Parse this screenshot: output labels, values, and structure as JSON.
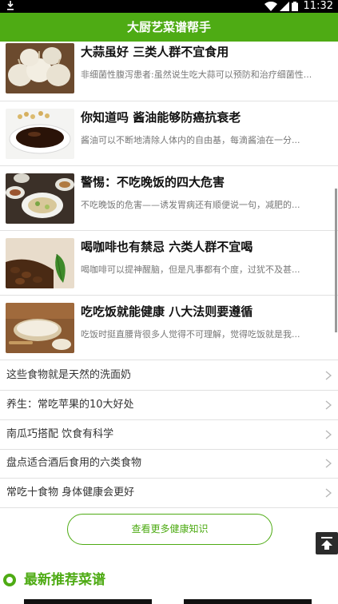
{
  "status_bar": {
    "download_icon": "download-icon",
    "time": "11:32"
  },
  "header": {
    "title": "大厨艺菜谱帮手"
  },
  "articles": [
    {
      "title": "大蒜虽好 三类人群不宜食用",
      "desc": "非细菌性腹泻患者:虽然说生吃大蒜可以预防和治疗细菌性...",
      "image": "garlic"
    },
    {
      "title": "你知道吗 酱油能够防癌抗衰老",
      "desc": "酱油可以不断地清除人体内的自由基，每滴酱油在一分...",
      "image": "soy-sauce"
    },
    {
      "title": "警惕：不吃晚饭的四大危害",
      "desc": "不吃晚饭的危害——诱发胃病还有顺便说一句，减肥的...",
      "image": "dinner-table"
    },
    {
      "title": "喝咖啡也有禁忌 六类人群不宜喝",
      "desc": "喝咖啡可以提神醒脑，但是凡事都有个度，过犹不及甚...",
      "image": "coffee-beans"
    },
    {
      "title": "吃吃饭就能健康 八大法则要遵循",
      "desc": "吃饭时挺直腰背很多人觉得不可理解，觉得吃饭就是我...",
      "image": "rice"
    }
  ],
  "links": [
    {
      "label": "这些食物就是天然的洗面奶"
    },
    {
      "label": "养生：常吃苹果的10大好处"
    },
    {
      "label": "南瓜巧搭配 饮食有科学"
    },
    {
      "label": "盘点适合酒后食用的六类食物"
    },
    {
      "label": "常吃十食物 身体健康会更好"
    }
  ],
  "more_button": {
    "label": "查看更多健康知识"
  },
  "back_to_top": {
    "icon": "back-to-top-icon"
  },
  "section": {
    "title": "最新推荐菜谱"
  },
  "colors": {
    "accent": "#4eab14",
    "statusbar": "#000000"
  }
}
